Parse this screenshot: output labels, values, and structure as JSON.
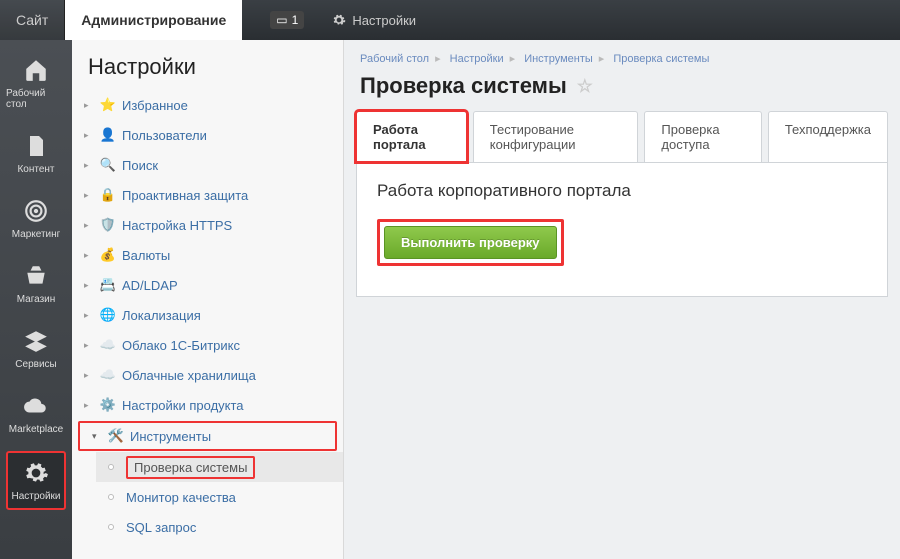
{
  "topbar": {
    "site_tab": "Сайт",
    "admin_tab": "Администрирование",
    "notif_count": "1",
    "settings_label": "Настройки"
  },
  "rail": {
    "items": [
      {
        "id": "desktop",
        "label": "Рабочий стол"
      },
      {
        "id": "content",
        "label": "Контент"
      },
      {
        "id": "marketing",
        "label": "Маркетинг"
      },
      {
        "id": "store",
        "label": "Магазин"
      },
      {
        "id": "services",
        "label": "Сервисы"
      },
      {
        "id": "marketplace",
        "label": "Marketplace"
      },
      {
        "id": "settings",
        "label": "Настройки"
      }
    ]
  },
  "tree": {
    "title": "Настройки",
    "items": [
      {
        "icon": "star",
        "label": "Избранное"
      },
      {
        "icon": "user",
        "label": "Пользователи"
      },
      {
        "icon": "search",
        "label": "Поиск"
      },
      {
        "icon": "lock",
        "label": "Проактивная защита"
      },
      {
        "icon": "https",
        "label": "Настройка HTTPS"
      },
      {
        "icon": "money",
        "label": "Валюты"
      },
      {
        "icon": "adldap",
        "label": "AD/LDAP"
      },
      {
        "icon": "globe",
        "label": "Локализация"
      },
      {
        "icon": "cloud1c",
        "label": "Облако 1С-Битрикс"
      },
      {
        "icon": "cloud",
        "label": "Облачные хранилища"
      },
      {
        "icon": "gear",
        "label": "Настройки продукта"
      },
      {
        "icon": "tools",
        "label": "Инструменты"
      }
    ],
    "tools_children": [
      {
        "label": "Проверка системы",
        "selected": true
      },
      {
        "label": "Монитор качества"
      },
      {
        "label": "SQL запрос"
      }
    ]
  },
  "breadcrumbs": [
    "Рабочий стол",
    "Настройки",
    "Инструменты",
    "Проверка системы"
  ],
  "page_title": "Проверка системы",
  "tabs": [
    {
      "label": "Работа портала",
      "active": true,
      "hl": true
    },
    {
      "label": "Тестирование конфигурации"
    },
    {
      "label": "Проверка доступа"
    },
    {
      "label": "Техподдержка"
    }
  ],
  "panel": {
    "heading": "Работа корпоративного портала",
    "run_button": "Выполнить проверку"
  }
}
